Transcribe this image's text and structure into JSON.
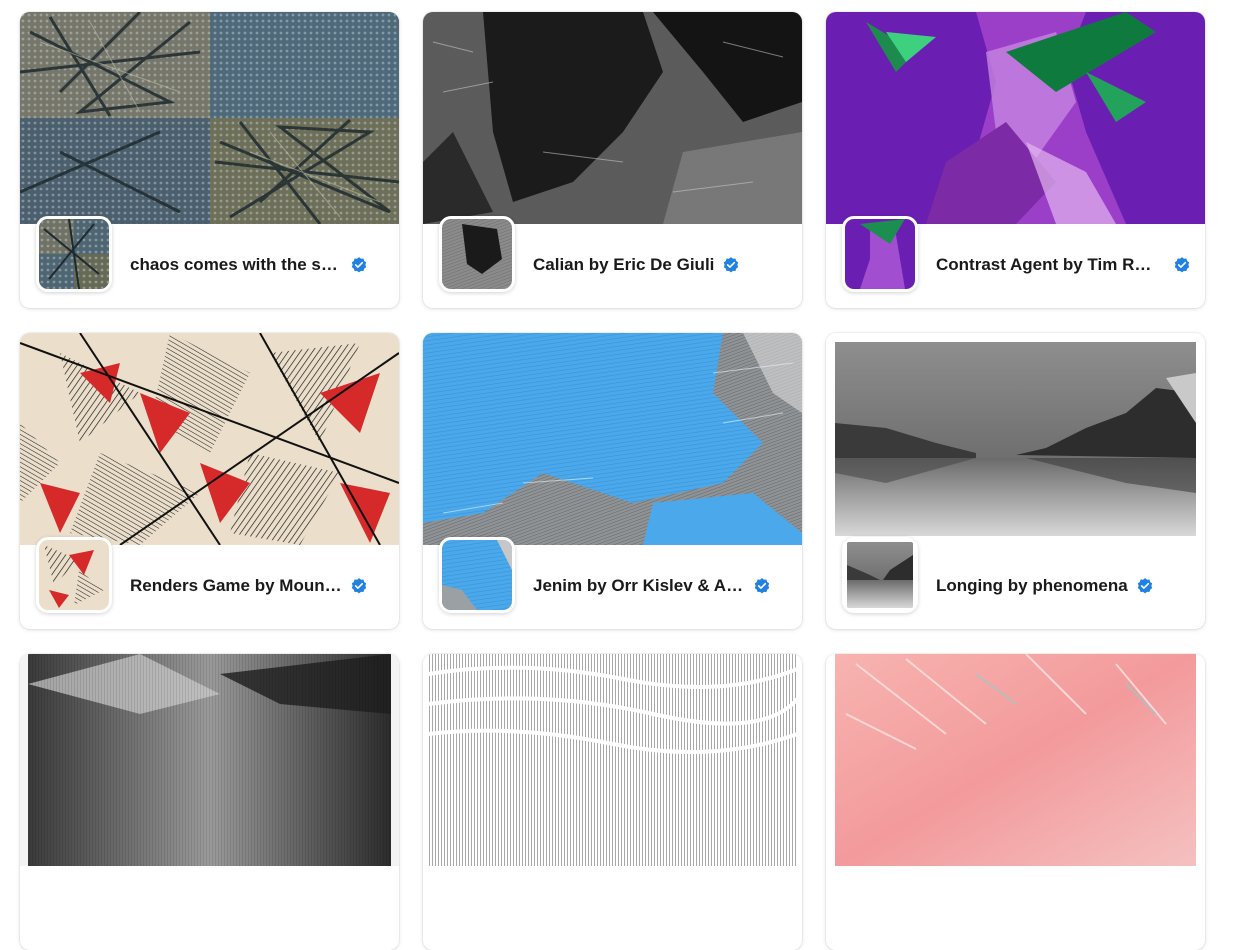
{
  "collections": [
    {
      "title": "chaos comes with the sun by Ismahelio",
      "verified": true,
      "icon": "verified-badge-icon"
    },
    {
      "title": "Calian by Eric De Giuli",
      "verified": true,
      "icon": "verified-badge-icon"
    },
    {
      "title": "Contrast Agent by Tim Richardson",
      "verified": true,
      "icon": "verified-badge-icon"
    },
    {
      "title": "Renders Game by MountVitruvius",
      "verified": true,
      "icon": "verified-badge-icon"
    },
    {
      "title": "Jenim by Orr Kislev & Alona Rodeh",
      "verified": true,
      "icon": "verified-badge-icon"
    },
    {
      "title": "Longing by phenomena",
      "verified": true,
      "icon": "verified-badge-icon"
    }
  ],
  "colors": {
    "verified_blue": "#2081e2",
    "title_text": "#1a1a1a"
  }
}
